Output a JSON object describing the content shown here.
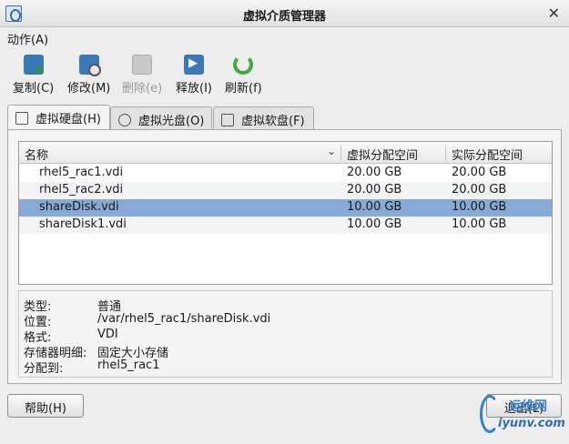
{
  "window": {
    "title": "虚拟介质管理器",
    "close_glyph": "✕"
  },
  "menu": {
    "action_label": "动作(A)"
  },
  "toolbar": [
    {
      "label": "复制(C)",
      "icon": "copy-icon",
      "enabled": true
    },
    {
      "label": "修改(M)",
      "icon": "edit-icon",
      "enabled": true
    },
    {
      "label": "删除(e)",
      "icon": "delete-icon",
      "enabled": false
    },
    {
      "label": "释放(I)",
      "icon": "release-icon",
      "enabled": true
    },
    {
      "label": "刷新(f)",
      "icon": "refresh-icon",
      "enabled": true
    }
  ],
  "tabs": [
    {
      "label": "虚拟硬盘(H)",
      "active": true,
      "icon": "hard-disk-icon"
    },
    {
      "label": "虚拟光盘(O)",
      "active": false,
      "icon": "optical-disk-icon"
    },
    {
      "label": "虚拟软盘(F)",
      "active": false,
      "icon": "floppy-disk-icon"
    }
  ],
  "table": {
    "columns": [
      "名称",
      "虚拟分配空间",
      "实际分配空间"
    ],
    "rows": [
      {
        "name": "rhel5_rac1.vdi",
        "virtual": "20.00 GB",
        "actual": "20.00 GB",
        "selected": false
      },
      {
        "name": "rhel5_rac2.vdi",
        "virtual": "20.00 GB",
        "actual": "20.00 GB",
        "selected": false
      },
      {
        "name": "shareDisk.vdi",
        "virtual": "10.00 GB",
        "actual": "10.00 GB",
        "selected": true
      },
      {
        "name": "shareDisk1.vdi",
        "virtual": "10.00 GB",
        "actual": "10.00 GB",
        "selected": false
      }
    ]
  },
  "details": [
    {
      "key": "类型:",
      "value": "普通"
    },
    {
      "key": "位置:",
      "value": "/var/rhel5_rac1/shareDisk.vdi"
    },
    {
      "key": "格式:",
      "value": "VDI"
    },
    {
      "key": "存储器明细:",
      "value": "固定大小存储"
    },
    {
      "key": "分配到:",
      "value": "rhel5_rac1"
    }
  ],
  "buttons": {
    "help": "帮助(H)",
    "exit": "退出(L)"
  },
  "watermark": {
    "top": "运维网",
    "bottom": "iyunv.com"
  },
  "colors": {
    "selection": "#86a9d5",
    "accent": "#3a78b8"
  }
}
